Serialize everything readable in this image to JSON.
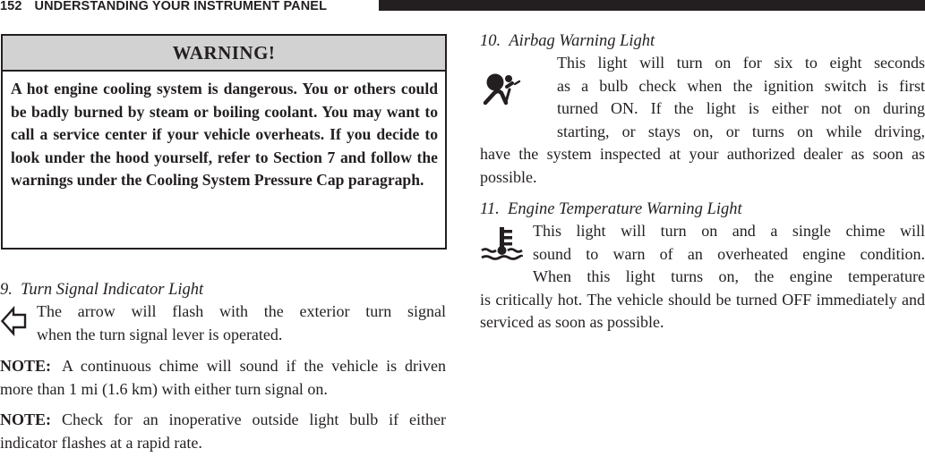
{
  "running_head": {
    "page_number": "152",
    "section_title": "UNDERSTANDING YOUR INSTRUMENT PANEL"
  },
  "warning": {
    "title": "WARNING!",
    "body": "A hot engine cooling system is dangerous. You or others could be badly burned by steam or boiling coolant. You may want to call a service center if your vehicle overheats. If you decide to look under the hood yourself, refer to Section 7 and follow the warnings under the Cooling System Pressure Cap paragraph."
  },
  "items": [
    {
      "number": "9.",
      "heading": "Turn Signal Indicator Light",
      "icon": "turn-signal-arrow-icon",
      "lines": [
        "The arrow will flash with the exterior turn signal",
        "when the turn signal lever is operated."
      ]
    },
    {
      "number": "10.",
      "heading": "Airbag Warning Light",
      "icon": "airbag-icon",
      "indented_lines": [
        "This light will turn on for six to eight seconds",
        "as a bulb check when the ignition switch is first",
        "turned ON. If the light is either not on during",
        "starting, or stays on, or turns on while driving,"
      ],
      "continuation": "have the system inspected at your authorized dealer as soon as possible."
    },
    {
      "number": "11.",
      "heading": "Engine Temperature Warning Light",
      "icon": "engine-temperature-icon",
      "indented_lines": [
        "This light will turn on and a single chime will",
        "sound to warn of an overheated engine condition.",
        "When this light turns on, the engine temperature"
      ],
      "continuation": "is critically hot. The vehicle should be turned OFF immediately and serviced as soon as possible."
    }
  ],
  "notes": [
    {
      "label": "NOTE:",
      "text": "A continuous chime will sound if the vehicle is driven more than 1 mi (1.6 km) with either turn signal on."
    },
    {
      "label": "NOTE:",
      "text": "Check for an inoperative outside light bulb if either indicator flashes at a rapid rate."
    }
  ]
}
